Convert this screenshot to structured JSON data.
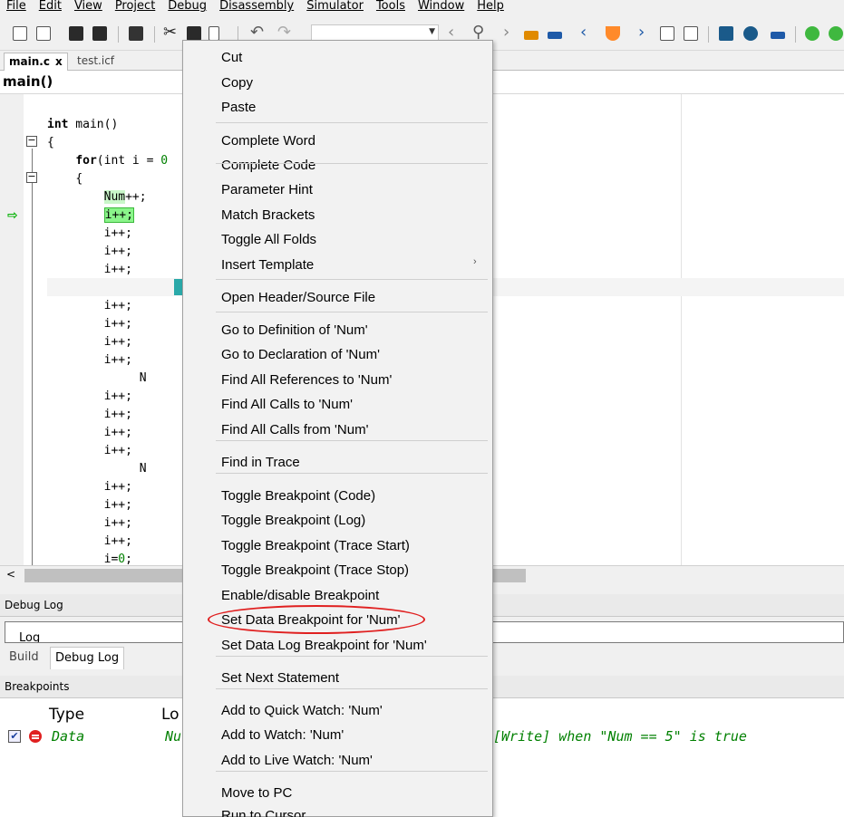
{
  "menubar": {
    "items": [
      "File",
      "Edit",
      "View",
      "Project",
      "Debug",
      "Disassembly",
      "Simulator",
      "Tools",
      "Window",
      "Help"
    ]
  },
  "tabs": [
    {
      "label": "main.c",
      "close": "x"
    },
    {
      "label": "test.icf"
    }
  ],
  "func_combo": "main()",
  "code": {
    "lines": [
      {
        "indent": "",
        "kw": "int",
        "text": " main()"
      },
      {
        "indent": "",
        "text": "{"
      },
      {
        "indent": "    ",
        "kw": "for",
        "text": "(int i = ",
        "num": "0"
      },
      {
        "indent": "    ",
        "text": "{"
      },
      {
        "indent": "        ",
        "hl": "Num",
        "text": "++;"
      },
      {
        "indent": "        ",
        "hl2": "i++;"
      },
      {
        "indent": "        ",
        "text": "i++;"
      },
      {
        "indent": "        ",
        "text": "i++;"
      },
      {
        "indent": "        ",
        "text": "i++;"
      },
      {
        "indent": "",
        "text": ""
      },
      {
        "indent": "        ",
        "text": "i++;"
      },
      {
        "indent": "        ",
        "text": "i++;"
      },
      {
        "indent": "        ",
        "text": "i++;"
      },
      {
        "indent": "        ",
        "text": "i++;"
      },
      {
        "indent": "             ",
        "text": "N"
      },
      {
        "indent": "        ",
        "text": "i++;"
      },
      {
        "indent": "        ",
        "text": "i++;"
      },
      {
        "indent": "        ",
        "text": "i++;"
      },
      {
        "indent": "        ",
        "text": "i++;"
      },
      {
        "indent": "             ",
        "text": "N"
      },
      {
        "indent": "        ",
        "text": "i++;"
      },
      {
        "indent": "        ",
        "text": "i++;"
      },
      {
        "indent": "        ",
        "text": "i++;"
      },
      {
        "indent": "        ",
        "text": "i++;"
      },
      {
        "indent": "        ",
        "text": "i=",
        "num": "0",
        "tail": ";"
      }
    ],
    "teal_letter": "N"
  },
  "panels": {
    "debug_log": "Debug Log",
    "log_partial": "Log",
    "bottom_tabs": [
      "Build",
      "Debug Log"
    ],
    "breakpoints": "Breakpoints"
  },
  "breakpoints": {
    "headers": [
      "Type",
      "Lo"
    ],
    "row": {
      "type": "Data",
      "loc": "Nu",
      "cond": "[Write] when \"Num == 5\" is true"
    }
  },
  "context_menu": {
    "items": [
      "Cut",
      "Copy",
      "Paste",
      "Complete Word",
      "Complete Code",
      "Parameter Hint",
      "Match Brackets",
      "Toggle All Folds",
      "Insert Template",
      "Open Header/Source File",
      "Go to Definition of 'Num'",
      "Go to Declaration of 'Num'",
      "Find All References to 'Num'",
      "Find All Calls to 'Num'",
      "Find All Calls from 'Num'",
      "Find in Trace",
      "Toggle Breakpoint (Code)",
      "Toggle Breakpoint (Log)",
      "Toggle Breakpoint (Trace Start)",
      "Toggle Breakpoint (Trace Stop)",
      "Enable/disable Breakpoint",
      "Set Data Breakpoint for 'Num'",
      "Set Data Log Breakpoint for 'Num'",
      "Set Next Statement",
      "Add to Quick Watch:  'Num'",
      "Add to Watch: 'Num'",
      "Add to Live Watch: 'Num'",
      "Move to PC",
      "Run to Cursor"
    ],
    "submenu_arrow": "›",
    "highlight_color": "#e02020"
  }
}
